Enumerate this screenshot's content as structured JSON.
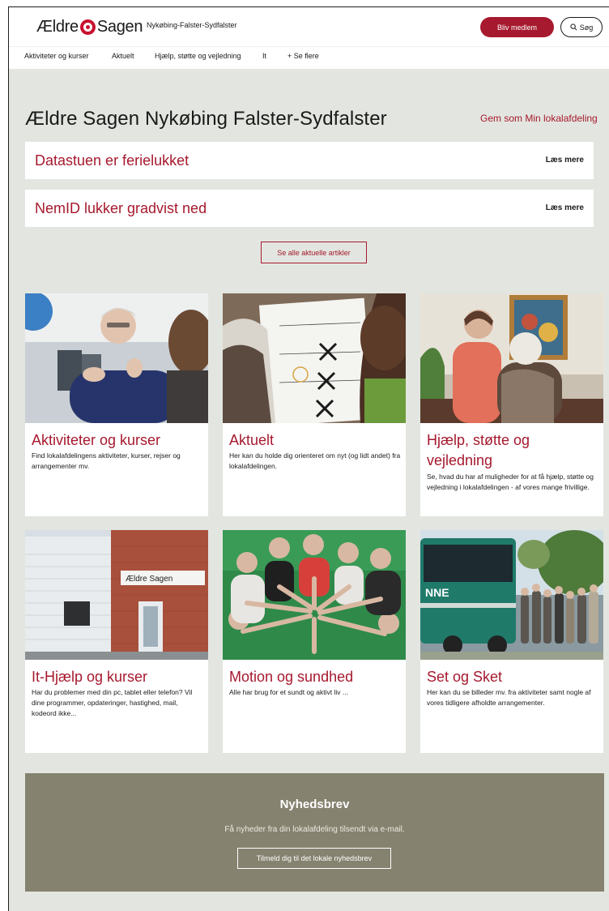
{
  "header": {
    "logo_left": "Ældre",
    "logo_right": "Sagen",
    "branch": "Nykøbing-Falster-Sydfalster",
    "join_label": "Bliv medlem",
    "search_label": "Søg"
  },
  "nav": {
    "items": [
      {
        "label": "Aktiviteter og kurser"
      },
      {
        "label": "Aktuelt"
      },
      {
        "label": "Hjælp, støtte og vejledning"
      },
      {
        "label": "It"
      },
      {
        "label": "+ Se flere"
      }
    ]
  },
  "page": {
    "title": "Ældre Sagen Nykøbing Falster-Sydfalster",
    "save_link": "Gem som Min lokalafdeling"
  },
  "articles": [
    {
      "title": "Datastuen er ferielukket",
      "more": "Læs mere"
    },
    {
      "title": "NemID lukker gradvist ned",
      "more": "Læs mere"
    }
  ],
  "see_all_label": "Se alle aktuelle artikler",
  "cards": [
    {
      "title": "Aktiviteter og kurser",
      "desc": "Find lokalafdelingens aktiviteter, kurser, rejser og arrangementer mv."
    },
    {
      "title": "Aktuelt",
      "desc": "Her kan du holde dig orienteret om nyt (og lidt andet) fra lokalafdelingen."
    },
    {
      "title": "Hjælp, støtte og vejledning",
      "desc": "Se, hvad du har af muligheder for at få hjælp, støtte og vejledning i lokalafdelingen - af vores mange frivillige."
    },
    {
      "title": "It-Hjælp og kurser",
      "desc": "Har du problemer med din pc, tablet eller telefon? Vil dine programmer, opdateringer, hastighed, mail, kodeord ikke..."
    },
    {
      "title": "Motion og sundhed",
      "desc": "Alle har brug for et sundt og aktivt liv ..."
    },
    {
      "title": "Set og Sket",
      "desc": "Her kan du se billeder mv. fra aktiviteter samt nogle af vores tidligere afholdte arrangementer."
    }
  ],
  "photo_text": {
    "building_sign": "Ældre Sagen",
    "bus_sign": "NNE"
  },
  "newsletter": {
    "title": "Nyhedsbrev",
    "text": "Få nyheder fra din lokalafdeling tilsendt via e-mail.",
    "button": "Tilmeld dig til det lokale nyhedsbrev"
  },
  "colors": {
    "brand_red": "#a6192e",
    "page_bg": "#e3e6e0",
    "newsletter_bg": "#85826f"
  }
}
